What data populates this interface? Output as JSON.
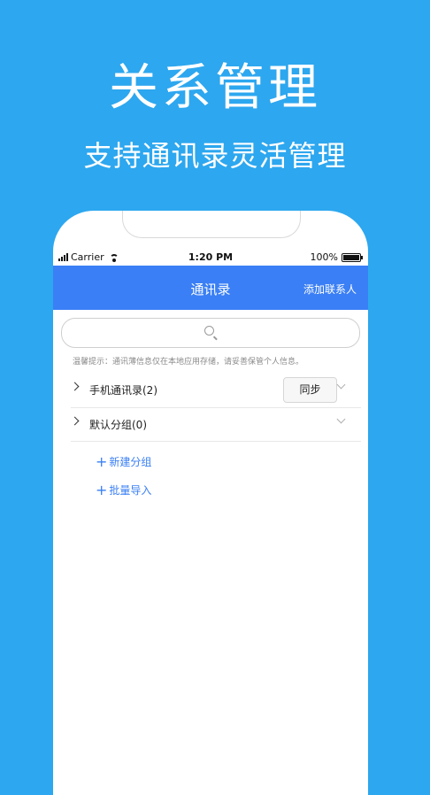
{
  "hero": {
    "title": "关系管理",
    "subtitle": "支持通讯录灵活管理"
  },
  "status_bar": {
    "carrier": "Carrier",
    "time": "1:20 PM",
    "battery": "100%"
  },
  "navbar": {
    "title": "通讯录",
    "add_contact": "添加联系人"
  },
  "search": {
    "placeholder": ""
  },
  "tip": "温馨提示：通讯薄信息仅在本地应用存储，请妥善保管个人信息。",
  "groups": [
    {
      "label": "手机通讯录(2)",
      "action": "同步"
    },
    {
      "label": "默认分组(0)"
    }
  ],
  "actions": {
    "new_group": "新建分组",
    "batch_import": "批量导入",
    "plus": "+"
  },
  "colors": {
    "background": "#2da7ef",
    "navbar": "#3a7ff5",
    "accent": "#3a7ff5"
  }
}
